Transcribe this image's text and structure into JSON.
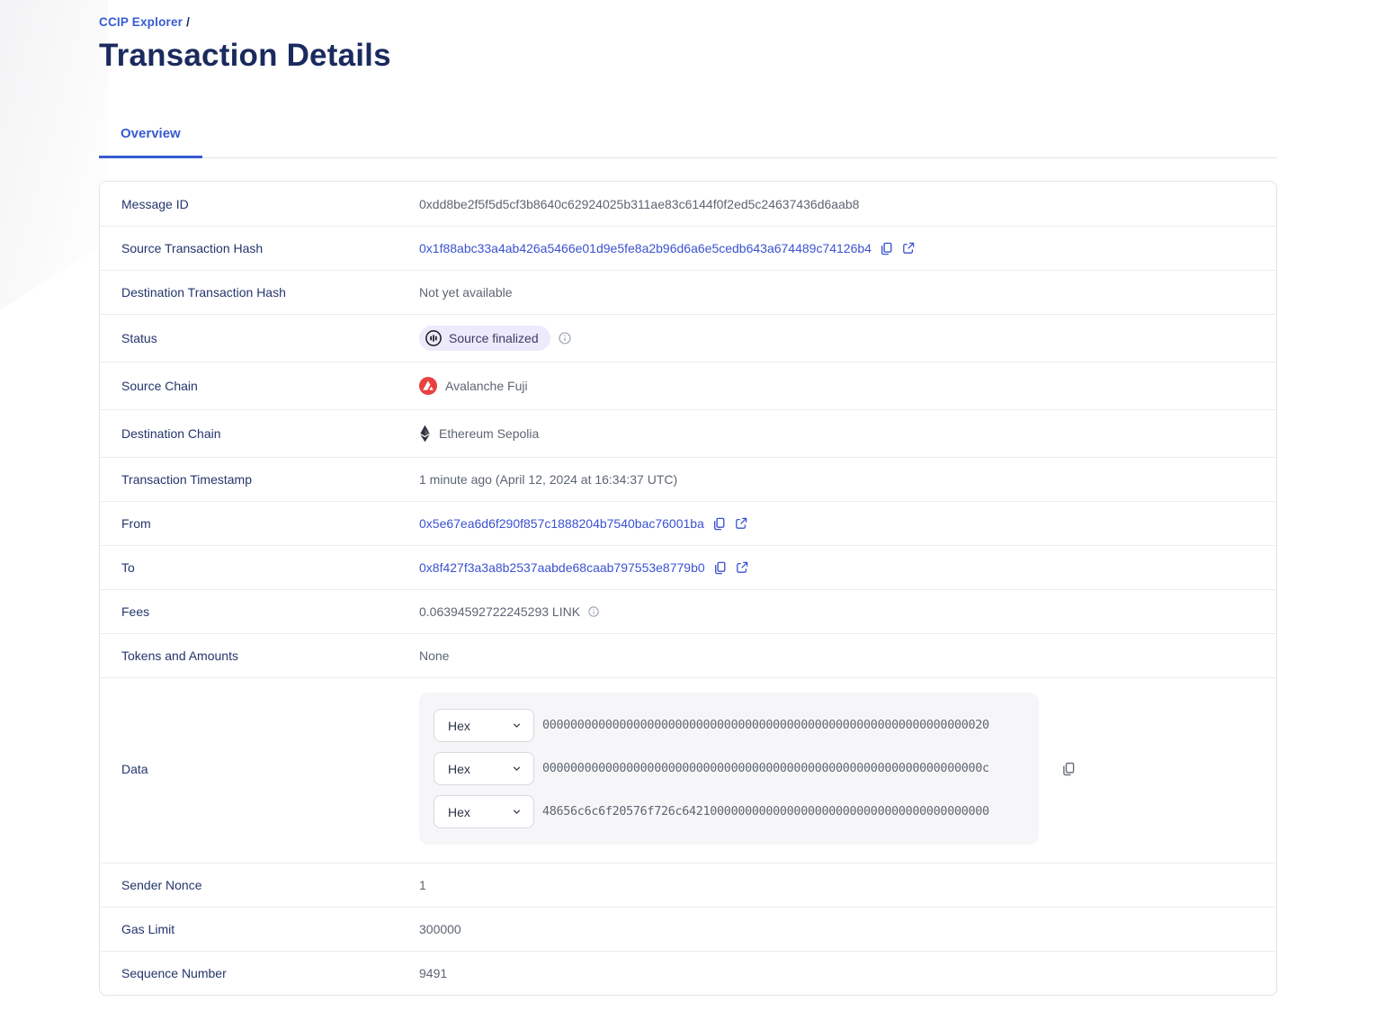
{
  "breadcrumb": {
    "link": "CCIP Explorer",
    "separator": "/"
  },
  "page": {
    "title": "Transaction Details"
  },
  "tabs": {
    "overview": "Overview"
  },
  "colors": {
    "accent": "#375bd2",
    "link": "#3a52d0",
    "title": "#1b2a5e",
    "badge_bg": "#eceafb",
    "avalanche_red": "#e84142"
  },
  "icons": {
    "copy": "copy-icon",
    "external_link": "external-link-icon",
    "info": "info-icon",
    "chevron_down": "chevron-down-icon",
    "status": "status-pending-icon",
    "avalanche": "avalanche-logo-icon",
    "ethereum": "ethereum-logo-icon"
  },
  "rows": {
    "message_id": {
      "label": "Message ID",
      "value": "0xdd8be2f5f5d5cf3b8640c62924025b311ae83c6144f0f2ed5c24637436d6aab8"
    },
    "source_tx_hash": {
      "label": "Source Transaction Hash",
      "value": "0x1f88abc33a4ab426a5466e01d9e5fe8a2b96d6a6e5cedb643a674489c74126b4"
    },
    "dest_tx_hash": {
      "label": "Destination Transaction Hash",
      "value": "Not yet available"
    },
    "status": {
      "label": "Status",
      "badge": "Source finalized"
    },
    "source_chain": {
      "label": "Source Chain",
      "value": "Avalanche Fuji"
    },
    "dest_chain": {
      "label": "Destination Chain",
      "value": "Ethereum Sepolia"
    },
    "timestamp": {
      "label": "Transaction Timestamp",
      "value": "1 minute ago (April 12, 2024 at 16:34:37 UTC)"
    },
    "from": {
      "label": "From",
      "value": "0x5e67ea6d6f290f857c1888204b7540bac76001ba"
    },
    "to": {
      "label": "To",
      "value": "0x8f427f3a3a8b2537aabde68caab797553e8779b0"
    },
    "fees": {
      "label": "Fees",
      "value": "0.06394592722245293 LINK"
    },
    "tokens": {
      "label": "Tokens and Amounts",
      "value": "None"
    },
    "data": {
      "label": "Data",
      "encoding": "Hex",
      "lines": [
        "0000000000000000000000000000000000000000000000000000000000000020",
        "000000000000000000000000000000000000000000000000000000000000000c",
        "48656c6c6f20576f726c64210000000000000000000000000000000000000000"
      ]
    },
    "sender_nonce": {
      "label": "Sender Nonce",
      "value": "1"
    },
    "gas_limit": {
      "label": "Gas Limit",
      "value": "300000"
    },
    "sequence_number": {
      "label": "Sequence Number",
      "value": "9491"
    }
  }
}
